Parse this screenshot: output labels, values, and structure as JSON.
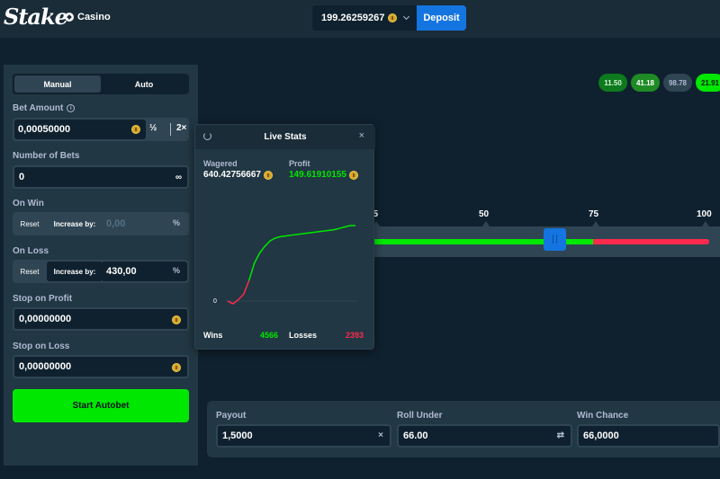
{
  "header": {
    "logo": "Stake",
    "nav_casino": "Casino",
    "balance": "199.26259267",
    "deposit": "Deposit"
  },
  "modes": {
    "manual": "Manual",
    "auto": "Auto"
  },
  "bet": {
    "label": "Bet Amount",
    "value": "0,00050000",
    "half": "½",
    "double": "2×"
  },
  "num_bets": {
    "label": "Number of Bets",
    "value": "0",
    "infinity": "∞"
  },
  "on_win": {
    "label": "On Win",
    "reset": "Reset",
    "increase": "Increase by:",
    "value": "0,00",
    "pct": "%"
  },
  "on_loss": {
    "label": "On Loss",
    "reset": "Reset",
    "increase": "Increase by:",
    "value": "430,00",
    "pct": "%"
  },
  "stop_profit": {
    "label": "Stop on Profit",
    "value": "0,00000000"
  },
  "stop_loss": {
    "label": "Stop on Loss",
    "value": "0,00000000"
  },
  "start_button": "Start Autobet",
  "recent_results": [
    "11.50",
    "41.18",
    "98.78",
    "21.91"
  ],
  "slider": {
    "ticks": [
      "25",
      "50",
      "75",
      "100"
    ],
    "roll_under": 66
  },
  "bottom": {
    "payout_label": "Payout",
    "payout_value": "1,5000",
    "payout_icon": "×",
    "roll_label": "Roll Under",
    "roll_value": "66.00",
    "roll_icon": "⇄",
    "chance_label": "Win Chance",
    "chance_value": "66,0000"
  },
  "live_stats": {
    "title": "Live Stats",
    "close": "×",
    "wagered_label": "Wagered",
    "wagered_value": "640.42756667",
    "profit_label": "Profit",
    "profit_value": "149.61910155",
    "wins_label": "Wins",
    "wins_value": "4566",
    "losses_label": "Losses",
    "losses_value": "2393",
    "chart_zero": "0",
    "profit_curve": [
      0,
      -4,
      2,
      10,
      30,
      55,
      70,
      80,
      88,
      92,
      94,
      95,
      96,
      97,
      98,
      99,
      100,
      101,
      102,
      103,
      104,
      106,
      108,
      110,
      110
    ]
  },
  "colors": {
    "green": "#00e701",
    "red": "#ff2a4d",
    "blue": "#1475e1"
  }
}
